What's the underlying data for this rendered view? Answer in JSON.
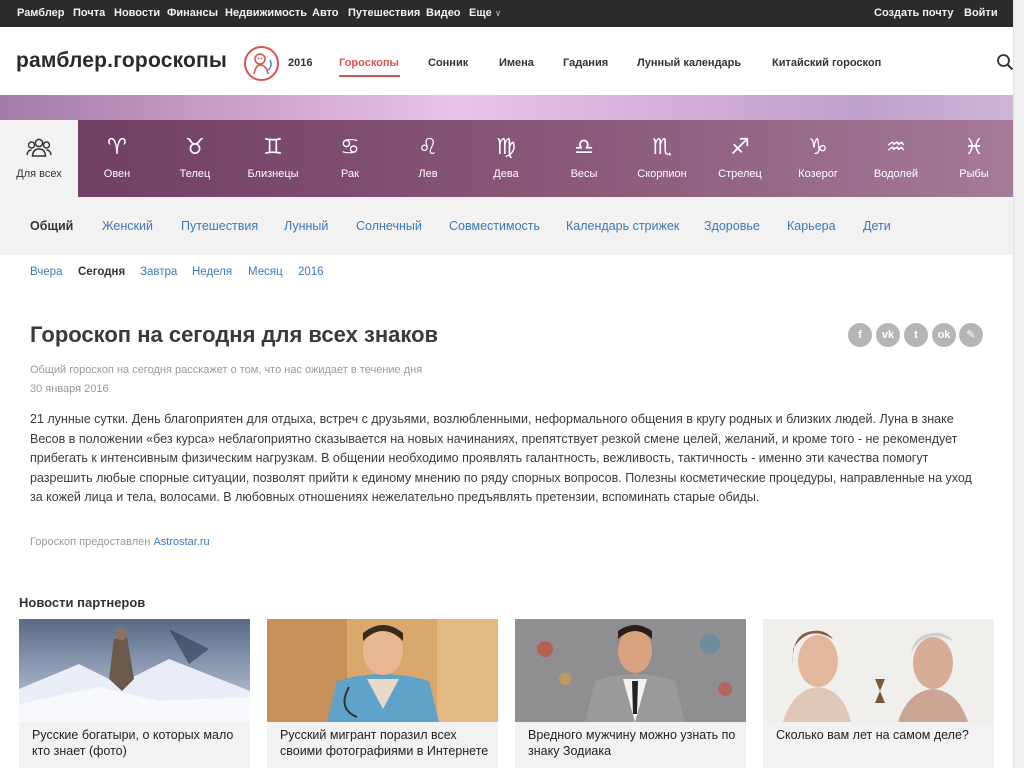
{
  "topbar": {
    "links": [
      "Рамблер",
      "Почта",
      "Новости",
      "Финансы",
      "Недвижимость",
      "Авто",
      "Путешествия",
      "Видео",
      "Еще"
    ],
    "create_mail": "Создать почту",
    "login": "Войти"
  },
  "header": {
    "logo": "рамблер.гороскопы",
    "year": "2016",
    "nav": [
      "Гороскопы",
      "Сонник",
      "Имена",
      "Гадания",
      "Лунный календарь",
      "Китайский гороскоп"
    ],
    "active_nav": "Гороскопы",
    "accent_color": "#d9534f"
  },
  "zodiac": {
    "items": [
      {
        "label": "Для всех",
        "icon": "people-icon",
        "glyph": ""
      },
      {
        "label": "Овен",
        "icon": "aries-icon",
        "glyph": "♈"
      },
      {
        "label": "Телец",
        "icon": "taurus-icon",
        "glyph": "♉"
      },
      {
        "label": "Близнецы",
        "icon": "gemini-icon",
        "glyph": "♊"
      },
      {
        "label": "Рак",
        "icon": "cancer-icon",
        "glyph": "♋"
      },
      {
        "label": "Лев",
        "icon": "leo-icon",
        "glyph": "♌"
      },
      {
        "label": "Дева",
        "icon": "virgo-icon",
        "glyph": "♍"
      },
      {
        "label": "Весы",
        "icon": "libra-icon",
        "glyph": "♎"
      },
      {
        "label": "Скорпион",
        "icon": "scorpio-icon",
        "glyph": "♏"
      },
      {
        "label": "Стрелец",
        "icon": "sagittarius-icon",
        "glyph": "♐"
      },
      {
        "label": "Козерог",
        "icon": "capricorn-icon",
        "glyph": "♑"
      },
      {
        "label": "Водолей",
        "icon": "aquarius-icon",
        "glyph": "♒"
      },
      {
        "label": "Рыбы",
        "icon": "pisces-icon",
        "glyph": "♓"
      }
    ]
  },
  "categories": [
    "Общий",
    "Женский",
    "Путешествия",
    "Лунный",
    "Солнечный",
    "Совместимость",
    "Календарь стрижек",
    "Здоровье",
    "Карьера",
    "Дети"
  ],
  "dates": [
    "Вчера",
    "Сегодня",
    "Завтра",
    "Неделя",
    "Месяц",
    "2016"
  ],
  "article": {
    "title": "Гороскоп на сегодня для всех знаков",
    "subtitle": "Общий гороскоп на сегодня расскажет о том, что нас ожидает в течение дня",
    "date": "30 января 2016",
    "body": "21 лунные сутки. День благоприятен для отдыха, встреч с друзьями, возлюбленными, неформального общения в кругу родных и близких людей. Луна в знаке Весов в положении «без курса» неблагоприятно сказывается на новых начинаниях, препятствует резкой смене целей, желаний, и кроме того - не рекомендует прибегать к интенсивным физическим нагрузкам. В общении необходимо проявлять галантность, вежливость, тактичность - именно эти качества помогут разрешить любые спорные ситуации, позволят прийти к единому мнению по ряду спорных вопросов. Полезны косметические процедуры, направленные на уход за кожей лица и тела, волосами. В любовных отношениях нежелательно предъявлять претензии, вспоминать старые обиды.",
    "source_prefix": "Гороскоп предоставлен",
    "source_link": "Astrostar.ru",
    "share": [
      {
        "icon": "facebook-icon",
        "glyph": "f"
      },
      {
        "icon": "vk-icon",
        "glyph": "vk"
      },
      {
        "icon": "twitter-icon",
        "glyph": "t"
      },
      {
        "icon": "odnoklassniki-icon",
        "glyph": "ok"
      },
      {
        "icon": "livejournal-icon",
        "glyph": "✎"
      }
    ]
  },
  "partners": {
    "title": "Новости партнеров",
    "cards": [
      {
        "caption": "Русские богатыри, о которых мало кто знает (фото)"
      },
      {
        "caption": "Русский мигрант поразил всех своими фотографиями в Интернете"
      },
      {
        "caption": "Вредного мужчину можно узнать по знаку Зодиака"
      },
      {
        "caption": "Сколько вам лет на самом деле?"
      }
    ]
  }
}
